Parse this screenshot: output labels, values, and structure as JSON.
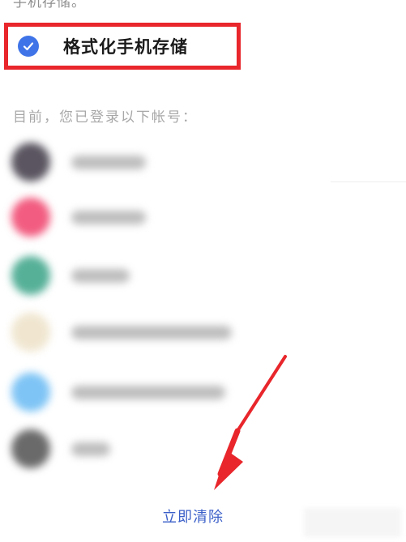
{
  "header": {
    "cut_text": "手机存储。"
  },
  "format_option": {
    "label": "格式化手机存储",
    "checked": true
  },
  "accounts": {
    "intro": "目前，您已登录以下帐号："
  },
  "actions": {
    "clear_now": "立即清除"
  },
  "colors": {
    "accent": "#3f74e8",
    "highlight": "#e8262b",
    "link": "#3b5fc8"
  },
  "icons": {
    "check": "check-icon",
    "arrow": "arrow-annotation"
  }
}
